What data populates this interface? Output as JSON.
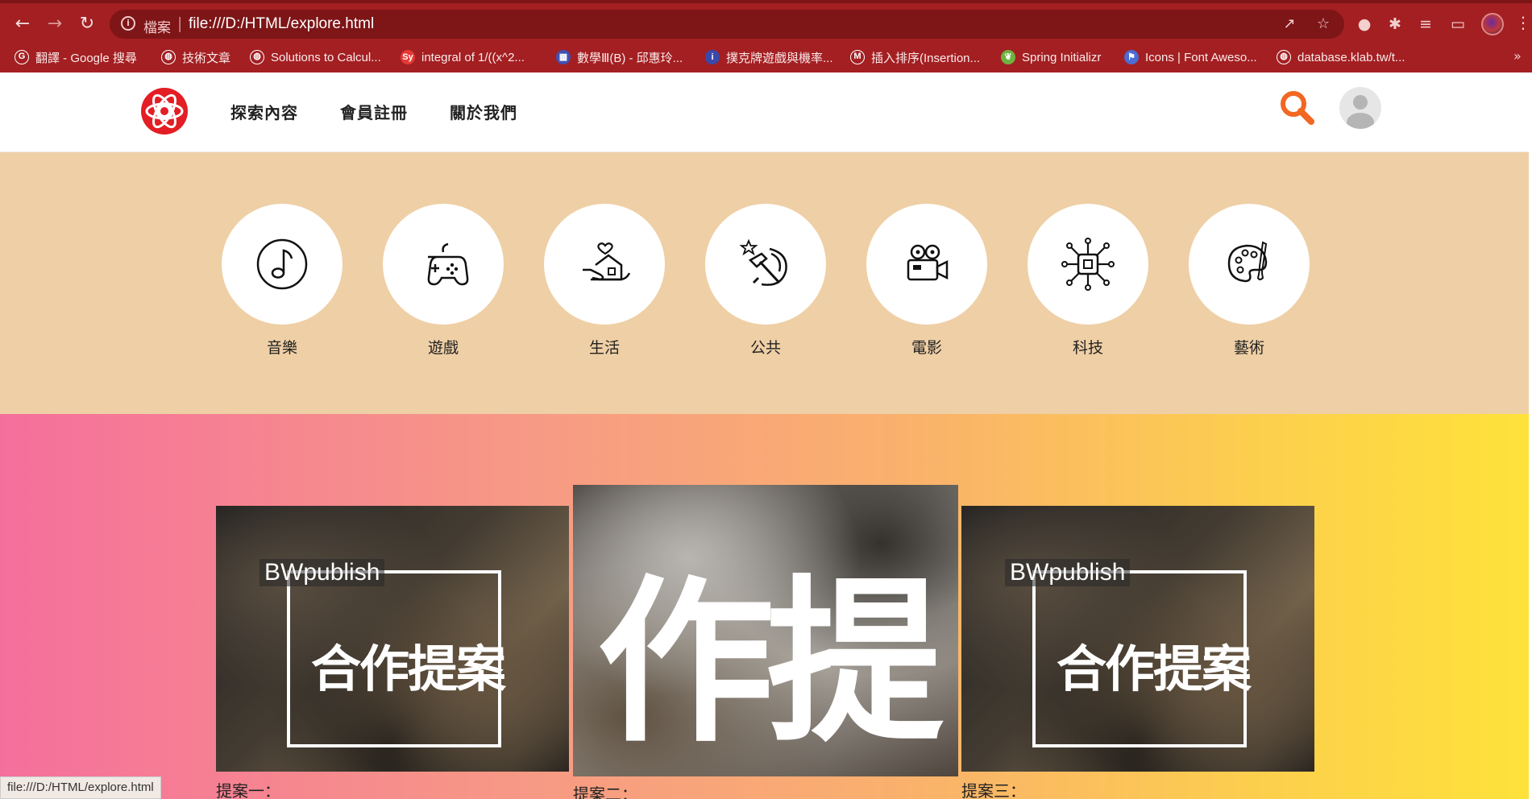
{
  "browser": {
    "scheme_label": "檔案",
    "separator": "|",
    "url": "file:///D:/HTML/explore.html",
    "status_url": "file:///D:/HTML/explore.html",
    "bookmarks": [
      {
        "label": "翻譯 - Google 搜尋",
        "icon": "google-icon",
        "color": "#ffffff"
      },
      {
        "label": "技術文章",
        "icon": "globe-icon",
        "color": "#ffffff"
      },
      {
        "label": "Solutions to Calcul...",
        "icon": "globe-icon",
        "color": "#ffffff"
      },
      {
        "label": "integral of 1/((x^2...",
        "icon": "symbolab-icon",
        "color": "#e53935"
      },
      {
        "label": "數學Ⅲ(B) - 邱惠玲...",
        "icon": "calendar-icon",
        "color": "#3f51b5"
      },
      {
        "label": "撲克牌遊戲與機率...",
        "icon": "info-icon",
        "color": "#3949ab"
      },
      {
        "label": "插入排序(Insertion...",
        "icon": "m-icon",
        "color": "#ffffff"
      },
      {
        "label": "Spring Initializr",
        "icon": "spring-icon",
        "color": "#6db33f"
      },
      {
        "label": "Icons | Font Aweso...",
        "icon": "flag-icon",
        "color": "#4a6cd4"
      },
      {
        "label": "database.klab.tw/t...",
        "icon": "globe-icon",
        "color": "#ffffff"
      }
    ]
  },
  "header": {
    "nav": [
      {
        "label": "探索內容"
      },
      {
        "label": "會員註冊"
      },
      {
        "label": "關於我們"
      }
    ],
    "accent_color": "#f26722"
  },
  "categories": [
    {
      "label": "音樂",
      "icon": "music-note-icon"
    },
    {
      "label": "遊戲",
      "icon": "gamepad-icon"
    },
    {
      "label": "生活",
      "icon": "home-heart-icon"
    },
    {
      "label": "公共",
      "icon": "hammer-sickle-icon"
    },
    {
      "label": "電影",
      "icon": "movie-camera-icon"
    },
    {
      "label": "科技",
      "icon": "chip-icon"
    },
    {
      "label": "藝術",
      "icon": "palette-icon"
    }
  ],
  "cards": [
    {
      "brand": "BWpublish",
      "title": "合作提案",
      "caption": "提案一："
    },
    {
      "brand": "",
      "title": "作提",
      "caption": "提案二："
    },
    {
      "brand": "BWpublish",
      "title": "合作提案",
      "caption": "提案三："
    }
  ]
}
